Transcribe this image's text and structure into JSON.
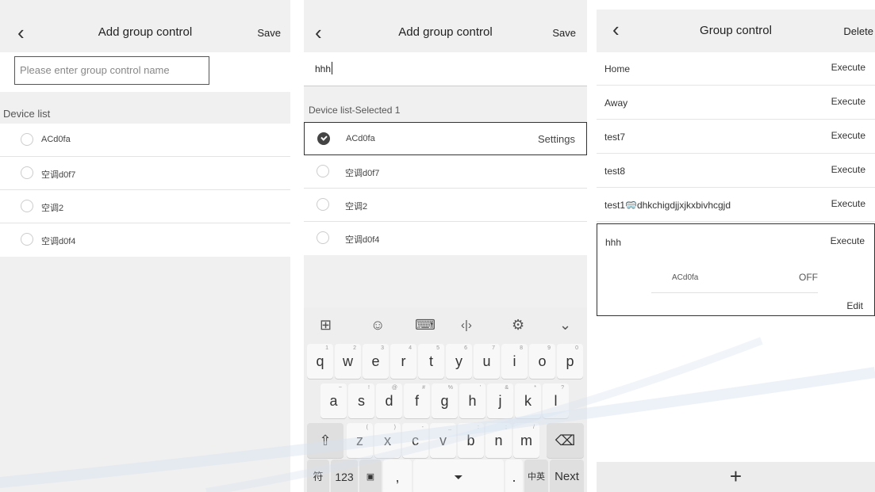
{
  "panel1": {
    "back_icon": "chevron-left-icon",
    "title": "Add group control",
    "save_label": "Save",
    "name_placeholder": "Please enter group control name",
    "section_label": "Device list",
    "devices": [
      {
        "label": "ACd0fa",
        "selected": false
      },
      {
        "label": "空调d0f7",
        "selected": false
      },
      {
        "label": "空调2",
        "selected": false
      },
      {
        "label": "空调d0f4",
        "selected": false
      }
    ]
  },
  "panel2": {
    "back_icon": "chevron-left-icon",
    "title": "Add group control",
    "save_label": "Save",
    "name_value": "hhh",
    "section_label": "Device list-Selected 1",
    "devices": [
      {
        "label": "ACd0fa",
        "selected": true,
        "action": "Settings"
      },
      {
        "label": "空调d0f7",
        "selected": false
      },
      {
        "label": "空调2",
        "selected": false
      },
      {
        "label": "空调d0f4",
        "selected": false
      }
    ],
    "keyboard": {
      "toolbar_icons": [
        "grid-icon",
        "emoji-icon",
        "keyboard-icon",
        "cursor-icon",
        "gear-icon",
        "chevron-down-icon"
      ],
      "row1": [
        [
          "q",
          "1"
        ],
        [
          "w",
          "2"
        ],
        [
          "e",
          "3"
        ],
        [
          "r",
          "4"
        ],
        [
          "t",
          "5"
        ],
        [
          "y",
          "6"
        ],
        [
          "u",
          "7"
        ],
        [
          "i",
          "8"
        ],
        [
          "o",
          "9"
        ],
        [
          "p",
          "0"
        ]
      ],
      "row2": [
        [
          "a",
          "~"
        ],
        [
          "s",
          "!"
        ],
        [
          "d",
          "@"
        ],
        [
          "f",
          "#"
        ],
        [
          "g",
          "%"
        ],
        [
          "h",
          "'"
        ],
        [
          "j",
          "&"
        ],
        [
          "k",
          "*"
        ],
        [
          "l",
          "?"
        ]
      ],
      "row3": [
        [
          "z",
          "("
        ],
        [
          "x",
          ")"
        ],
        [
          "c",
          "-"
        ],
        [
          "v",
          "_"
        ],
        [
          "b",
          ":"
        ],
        [
          "n",
          ";"
        ],
        [
          "m",
          "/"
        ]
      ],
      "row4": {
        "sym": "符",
        "num": "123",
        "comma": ",",
        "period": ".",
        "lang": "中英",
        "next": "Next"
      },
      "shift_icon": "⇧",
      "delete_icon": "⌫"
    }
  },
  "panel3": {
    "back_icon": "chevron-left-icon",
    "title": "Group control",
    "delete_label": "Delete",
    "groups": [
      {
        "name": "Home",
        "action": "Execute"
      },
      {
        "name": "Away",
        "action": "Execute"
      },
      {
        "name": "test7",
        "action": "Execute"
      },
      {
        "name": "test8",
        "action": "Execute"
      },
      {
        "name": "test1🥽dhkchigdjjxjkxbivhcgjd",
        "action": "Execute"
      }
    ],
    "expanded": {
      "name": "hhh",
      "action": "Execute",
      "device": "ACd0fa",
      "state": "OFF",
      "edit_label": "Edit"
    },
    "add_icon": "plus-icon",
    "add_glyph": "+"
  }
}
